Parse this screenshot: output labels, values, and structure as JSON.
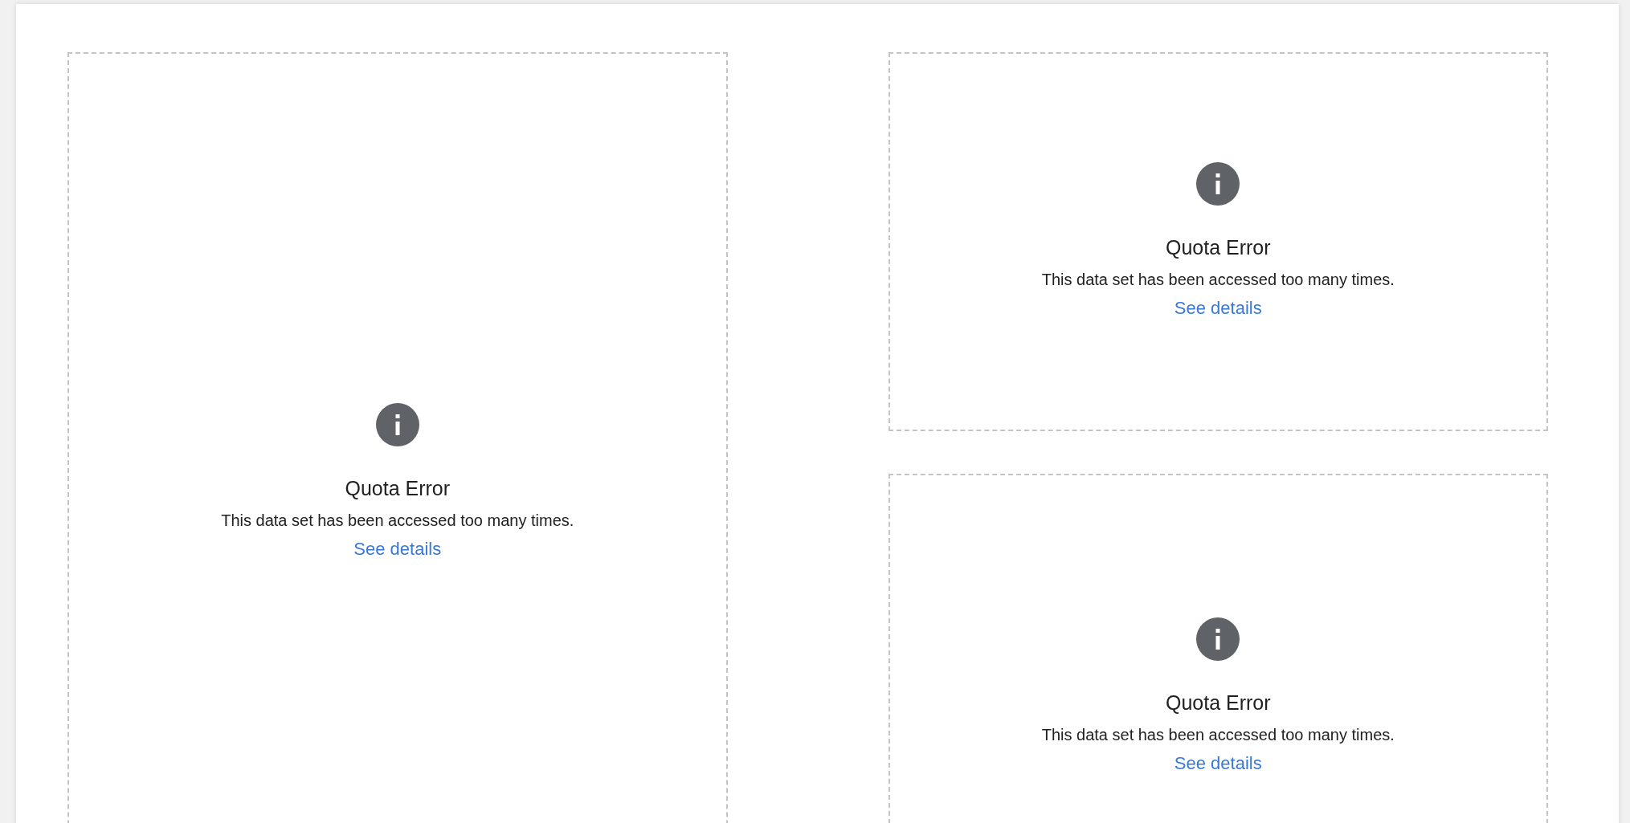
{
  "panels": [
    {
      "title": "Quota Error",
      "message": "This data set has been accessed too many times.",
      "link": "See details"
    },
    {
      "title": "Quota Error",
      "message": "This data set has been accessed too many times.",
      "link": "See details"
    },
    {
      "title": "Quota Error",
      "message": "This data set has been accessed too many times.",
      "link": "See details"
    }
  ]
}
